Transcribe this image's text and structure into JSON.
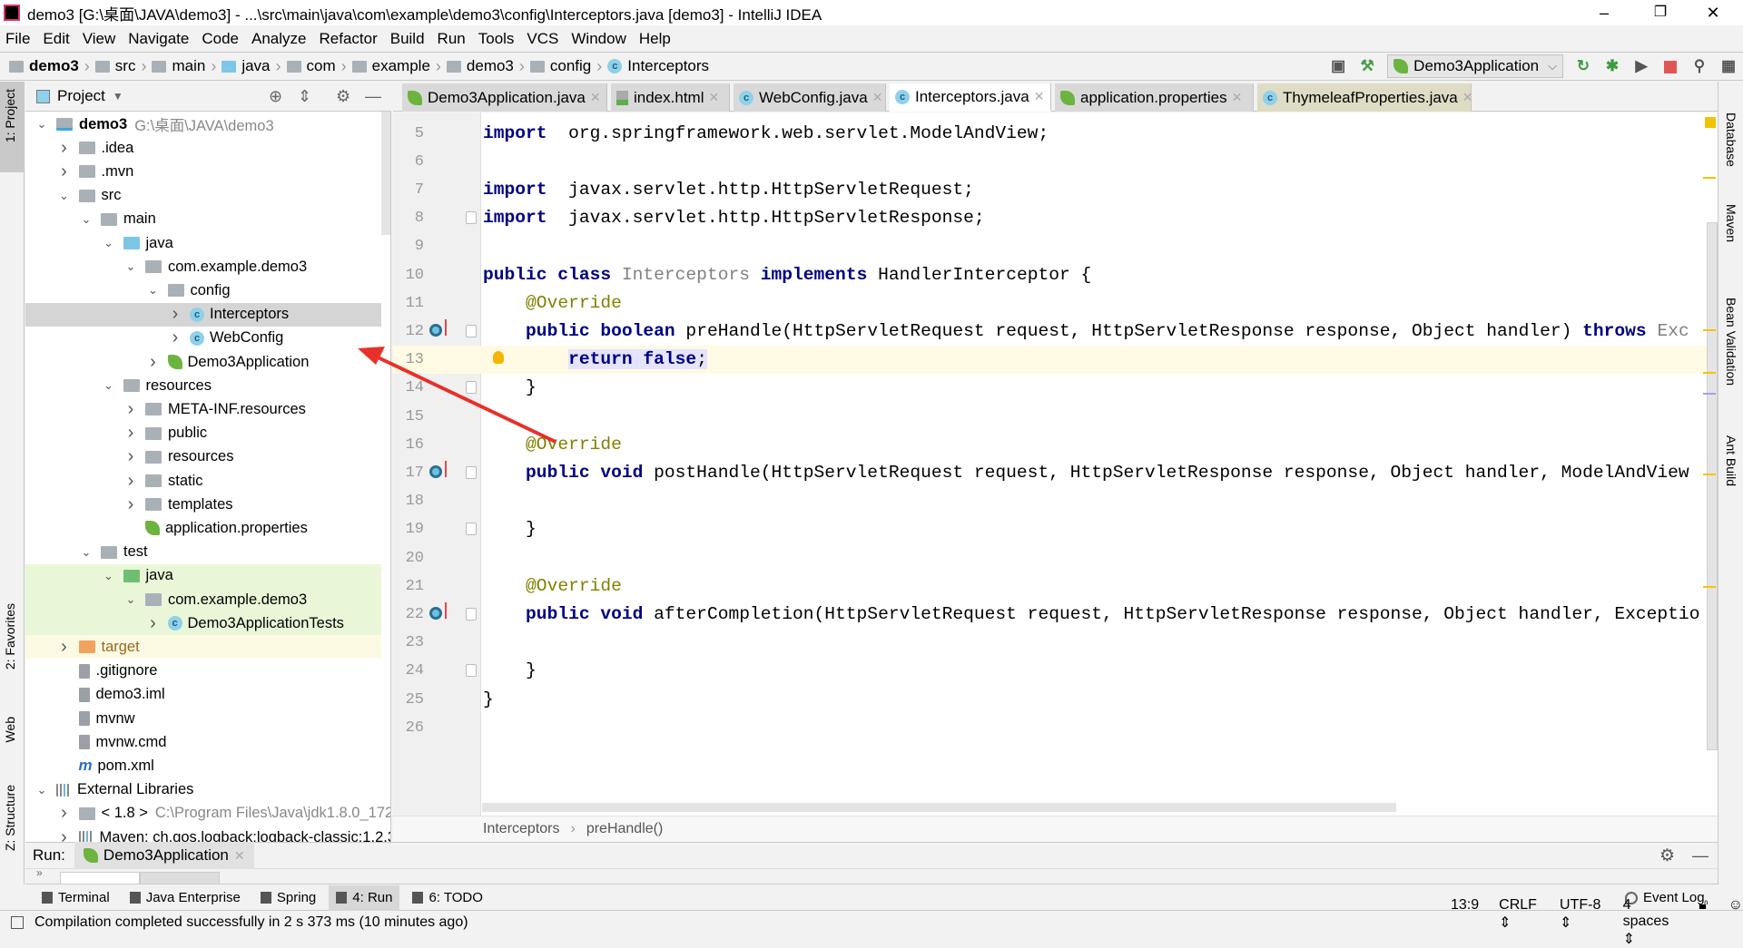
{
  "window": {
    "title": "demo3 [G:\\桌面\\JAVA\\demo3] - ...\\src\\main\\java\\com\\example\\demo3\\config\\Interceptors.java [demo3] - IntelliJ IDEA",
    "logo": "IJ",
    "minimize": "–",
    "restore": "❐",
    "close": "✕"
  },
  "menu": [
    "File",
    "Edit",
    "View",
    "Navigate",
    "Code",
    "Analyze",
    "Refactor",
    "Build",
    "Run",
    "Tools",
    "VCS",
    "Window",
    "Help"
  ],
  "navbar": {
    "crumbs": [
      "demo3",
      "src",
      "main",
      "java",
      "com",
      "example",
      "demo3",
      "config",
      "Interceptors"
    ],
    "run_config": "Demo3Application"
  },
  "project": {
    "title": "Project",
    "tree": [
      {
        "d": 0,
        "a": "v",
        "i": "module",
        "l": "demo3",
        "x": "G:\\桌面\\JAVA\\demo3",
        "b": true
      },
      {
        "d": 1,
        "a": ">",
        "i": "folder",
        "l": ".idea"
      },
      {
        "d": 1,
        "a": ">",
        "i": "folder",
        "l": ".mvn"
      },
      {
        "d": 1,
        "a": "v",
        "i": "folder",
        "l": "src"
      },
      {
        "d": 2,
        "a": "v",
        "i": "folder",
        "l": "main"
      },
      {
        "d": 3,
        "a": "v",
        "i": "blue",
        "l": "java"
      },
      {
        "d": 4,
        "a": "v",
        "i": "package",
        "l": "com.example.demo3"
      },
      {
        "d": 5,
        "a": "v",
        "i": "package",
        "l": "config"
      },
      {
        "d": 6,
        "a": ">",
        "i": "class",
        "l": "Interceptors",
        "s": "sel"
      },
      {
        "d": 6,
        "a": ">",
        "i": "class",
        "l": "WebConfig"
      },
      {
        "d": 5,
        "a": ">",
        "i": "spring",
        "l": "Demo3Application"
      },
      {
        "d": 3,
        "a": "v",
        "i": "folder",
        "l": "resources"
      },
      {
        "d": 4,
        "a": ">",
        "i": "folder",
        "l": "META-INF.resources"
      },
      {
        "d": 4,
        "a": ">",
        "i": "folder",
        "l": "public"
      },
      {
        "d": 4,
        "a": ">",
        "i": "folder",
        "l": "resources"
      },
      {
        "d": 4,
        "a": ">",
        "i": "folder",
        "l": "static"
      },
      {
        "d": 4,
        "a": ">",
        "i": "folder",
        "l": "templates"
      },
      {
        "d": 4,
        "a": "",
        "i": "spring",
        "l": "application.properties"
      },
      {
        "d": 2,
        "a": "v",
        "i": "folder",
        "l": "test"
      },
      {
        "d": 3,
        "a": "v",
        "i": "greenf",
        "l": "java",
        "s": "green"
      },
      {
        "d": 4,
        "a": "v",
        "i": "package",
        "l": "com.example.demo3",
        "s": "green"
      },
      {
        "d": 5,
        "a": ">",
        "i": "class",
        "l": "Demo3ApplicationTests",
        "s": "green"
      },
      {
        "d": 1,
        "a": ">",
        "i": "orange",
        "l": "target",
        "s": "yellow"
      },
      {
        "d": 1,
        "a": "",
        "i": "file",
        "l": ".gitignore"
      },
      {
        "d": 1,
        "a": "",
        "i": "file",
        "l": "demo3.iml"
      },
      {
        "d": 1,
        "a": "",
        "i": "file",
        "l": "mvnw"
      },
      {
        "d": 1,
        "a": "",
        "i": "file",
        "l": "mvnw.cmd"
      },
      {
        "d": 1,
        "a": "",
        "i": "m",
        "l": "pom.xml"
      },
      {
        "d": 0,
        "a": "v",
        "i": "lib",
        "l": "External Libraries"
      },
      {
        "d": 1,
        "a": ">",
        "i": "folder",
        "l": "< 1.8 >",
        "x": "C:\\Program Files\\Java\\jdk1.8.0_172"
      },
      {
        "d": 1,
        "a": ">",
        "i": "lib",
        "l": "Maven: ch.qos.logback:logback-classic:1.2.3"
      }
    ]
  },
  "tabs": [
    {
      "l": "Demo3Application.java",
      "i": "spring",
      "w": 226
    },
    {
      "l": "index.html",
      "i": "html",
      "w": 131
    },
    {
      "l": "WebConfig.java",
      "i": "class",
      "w": 168
    },
    {
      "l": "Interceptors.java",
      "i": "class",
      "w": 178,
      "active": true
    },
    {
      "l": "application.properties",
      "i": "spring",
      "w": 219
    },
    {
      "l": "ThymeleafProperties.java",
      "i": "class",
      "w": 236,
      "olive": true
    }
  ],
  "code": [
    {
      "n": "5",
      "t": [
        [
          "kw",
          "import"
        ],
        [
          "",
          "  org.springframework.web.servlet.ModelAndView;"
        ]
      ]
    },
    {
      "n": "6",
      "t": []
    },
    {
      "n": "7",
      "t": [
        [
          "kw",
          "import"
        ],
        [
          "",
          "  javax.servlet.http.HttpServletRequest;"
        ]
      ]
    },
    {
      "n": "8",
      "t": [
        [
          "kw",
          "import"
        ],
        [
          "",
          "  javax.servlet.http.HttpServletResponse;"
        ]
      ],
      "f": 1
    },
    {
      "n": "9",
      "t": []
    },
    {
      "n": "10",
      "t": [
        [
          "kw",
          "public class"
        ],
        [
          "",
          " "
        ],
        [
          "gr",
          "Interceptors"
        ],
        [
          "",
          " "
        ],
        [
          "kw",
          "implements"
        ],
        [
          "",
          " HandlerInterceptor {"
        ]
      ]
    },
    {
      "n": "11",
      "t": [
        [
          "",
          "    "
        ],
        [
          "an",
          "@Override"
        ]
      ]
    },
    {
      "n": "12",
      "t": [
        [
          "",
          "    "
        ],
        [
          "kw",
          "public boolean"
        ],
        [
          "",
          " preHandle(HttpServletRequest request, HttpServletResponse response, Object handler) "
        ],
        [
          "kw",
          "throws"
        ],
        [
          "gr",
          " Exc"
        ]
      ],
      "o": 1,
      "f": 1
    },
    {
      "n": "13",
      "t": [
        [
          "",
          "        "
        ],
        [
          "kw selbg",
          "return false"
        ],
        [
          "selbg",
          ";"
        ]
      ],
      "hl": 1,
      "bulb": 1
    },
    {
      "n": "14",
      "t": [
        [
          "",
          "    }"
        ]
      ],
      "f": 1
    },
    {
      "n": "15",
      "t": []
    },
    {
      "n": "16",
      "t": [
        [
          "",
          "    "
        ],
        [
          "an",
          "@Override"
        ]
      ]
    },
    {
      "n": "17",
      "t": [
        [
          "",
          "    "
        ],
        [
          "kw",
          "public void"
        ],
        [
          "",
          " postHandle(HttpServletRequest request, HttpServletResponse response, Object handler, ModelAndView"
        ]
      ],
      "o": 1,
      "f": 1
    },
    {
      "n": "18",
      "t": []
    },
    {
      "n": "19",
      "t": [
        [
          "",
          "    }"
        ]
      ],
      "f": 1
    },
    {
      "n": "20",
      "t": []
    },
    {
      "n": "21",
      "t": [
        [
          "",
          "    "
        ],
        [
          "an",
          "@Override"
        ]
      ]
    },
    {
      "n": "22",
      "t": [
        [
          "",
          "    "
        ],
        [
          "kw",
          "public void"
        ],
        [
          "",
          " afterCompletion(HttpServletRequest request, HttpServletResponse response, Object handler, Exceptio"
        ]
      ],
      "o": 1,
      "f": 1
    },
    {
      "n": "23",
      "t": []
    },
    {
      "n": "24",
      "t": [
        [
          "",
          "    }"
        ]
      ],
      "f": 1
    },
    {
      "n": "25",
      "t": [
        [
          "",
          "}"
        ]
      ]
    },
    {
      "n": "26",
      "t": []
    }
  ],
  "editor_crumbs": [
    "Interceptors",
    "preHandle()"
  ],
  "run": {
    "label": "Run:",
    "tab": "Demo3Application",
    "more": "»"
  },
  "left_stripe": [
    "1: Project",
    "2: Favorites",
    "Web",
    "Z: Structure"
  ],
  "right_stripe": [
    "Database",
    "Maven",
    "Bean Validation",
    "Ant Build"
  ],
  "tool_buttons": [
    {
      "l": "Terminal"
    },
    {
      "l": "Java Enterprise"
    },
    {
      "l": "Spring"
    },
    {
      "l": "4: Run",
      "active": true
    },
    {
      "l": "6: TODO"
    }
  ],
  "event_log": "Event Log",
  "status": {
    "message": "Compilation completed successfully in 2 s 373 ms (10 minutes ago)",
    "position": "13:9",
    "line_sep": "CRLF ⇕",
    "encoding": "UTF-8 ⇕",
    "indent": "4 spaces ⇕"
  },
  "colors": {
    "keyword": "#000080",
    "annotation": "#808000",
    "current_line": "#fffae3",
    "selection": "#e4e4ff",
    "annotation_arrow": "#e8302a"
  }
}
